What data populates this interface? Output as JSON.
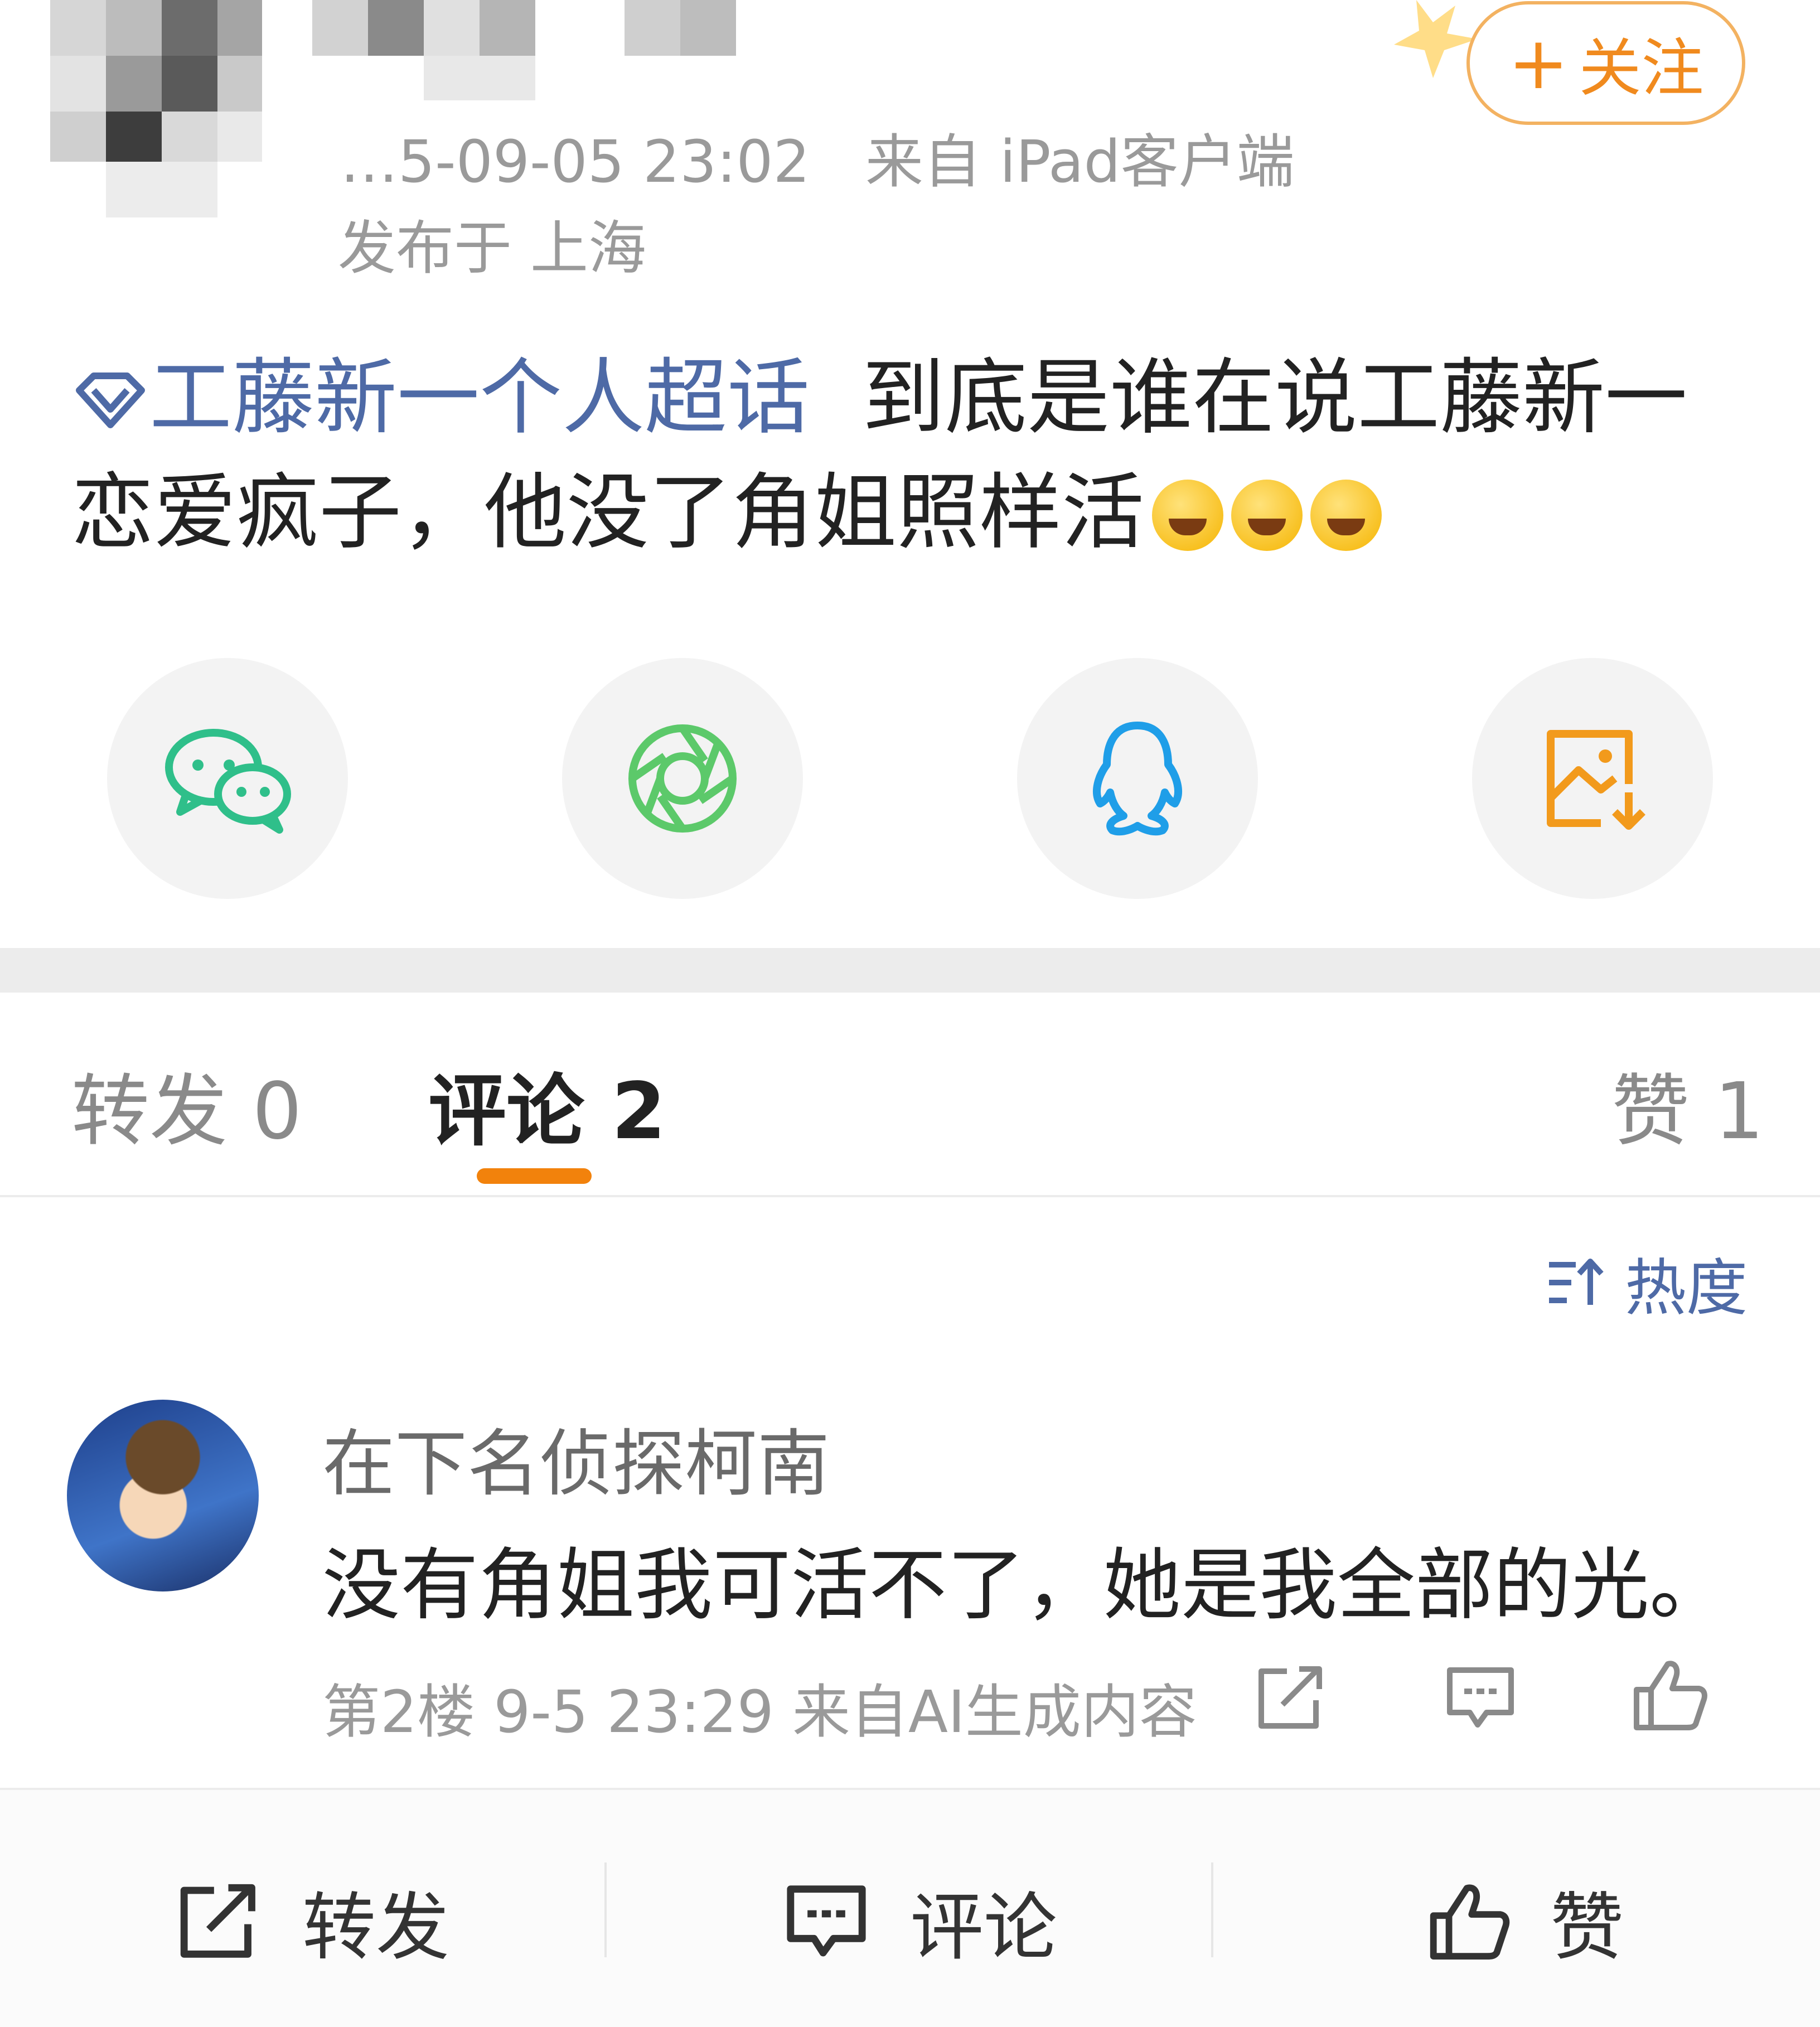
{
  "header": {
    "timestamp": "…5-09-05 23:02",
    "source": "来自 iPad客户端",
    "location": "发布于 上海",
    "follow_label": "关注",
    "follow_icon": "plus-icon"
  },
  "post": {
    "topic": "工藤新一个人超话",
    "text": "到底是谁在说工藤新一恋爱疯子，他没了角姐照样活",
    "emoji_count": 3,
    "emoji_name": "laughing-crying-emoji"
  },
  "share": {
    "items": [
      "wechat-icon",
      "moments-icon",
      "qq-icon",
      "save-image-icon"
    ],
    "colors": {
      "wechat": "#2fbf8a",
      "moments": "#5cc96a",
      "qq": "#1f9ee8",
      "save": "#f29a1c"
    }
  },
  "tabs": {
    "repost": "转发 0",
    "comment": "评论 2",
    "like": "赞 1"
  },
  "sort": {
    "label": "热度"
  },
  "comments": [
    {
      "user": "在下名侦探柯南",
      "text": "没有角姐我可活不了，她是我全部的光。",
      "meta": "第2楼 9-5 23:29 来自AI生成内容"
    }
  ],
  "bottom_bar": {
    "repost": "转发",
    "comment": "评论",
    "like": "赞"
  },
  "colors": {
    "accent": "#f2820c",
    "topic": "#4e6aa6"
  }
}
